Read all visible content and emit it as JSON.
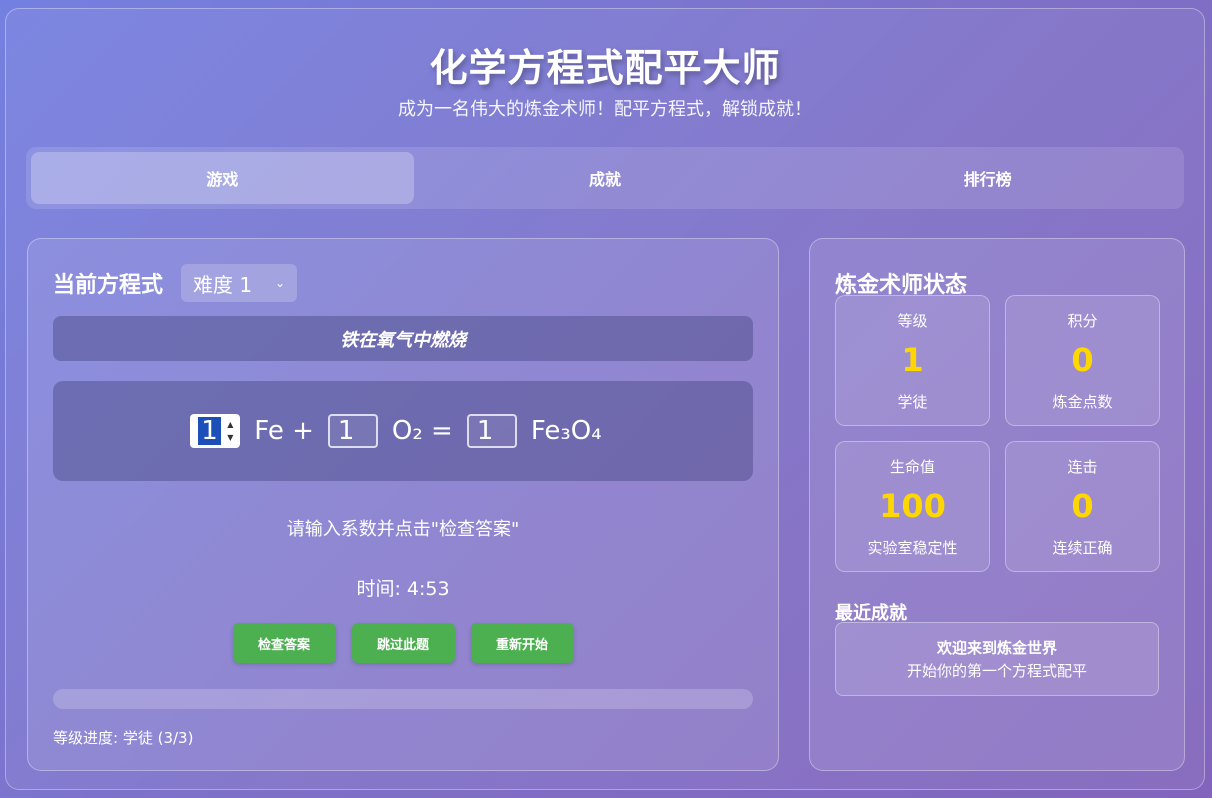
{
  "header": {
    "title": "化学方程式配平大师",
    "subtitle": "成为一名伟大的炼金术师！配平方程式，解锁成就！"
  },
  "tabs": [
    {
      "label": "游戏",
      "active": true
    },
    {
      "label": "成就",
      "active": false
    },
    {
      "label": "排行榜",
      "active": false
    }
  ],
  "game": {
    "heading": "当前方程式",
    "difficulty": "难度 1",
    "reaction_name": "铁在氧气中燃烧",
    "equation": {
      "coefficients": [
        "1",
        "1",
        "1"
      ],
      "fe": "Fe",
      "plus": "+",
      "o2": "O₂",
      "equals": "=",
      "product": "Fe₃O₄"
    },
    "hint": "请输入系数并点击\"检查答案\"",
    "timer": "时间: 4:53",
    "buttons": {
      "check": "检查答案",
      "skip": "跳过此题",
      "restart": "重新开始"
    },
    "progress_fraction": 0,
    "level_progress": "等级进度: 学徒 (3/3)"
  },
  "status": {
    "title": "炼金术师状态",
    "stats": [
      {
        "label": "等级",
        "value": "1",
        "sub": "学徒"
      },
      {
        "label": "积分",
        "value": "0",
        "sub": "炼金点数"
      },
      {
        "label": "生命值",
        "value": "100",
        "sub": "实验室稳定性"
      },
      {
        "label": "连击",
        "value": "0",
        "sub": "连续正确"
      }
    ],
    "recent_title": "最近成就",
    "recent": {
      "name": "欢迎来到炼金世界",
      "desc": "开始你的第一个方程式配平"
    }
  },
  "colors": {
    "accent_gold": "#ffd700",
    "button_green": "#4caf50"
  }
}
